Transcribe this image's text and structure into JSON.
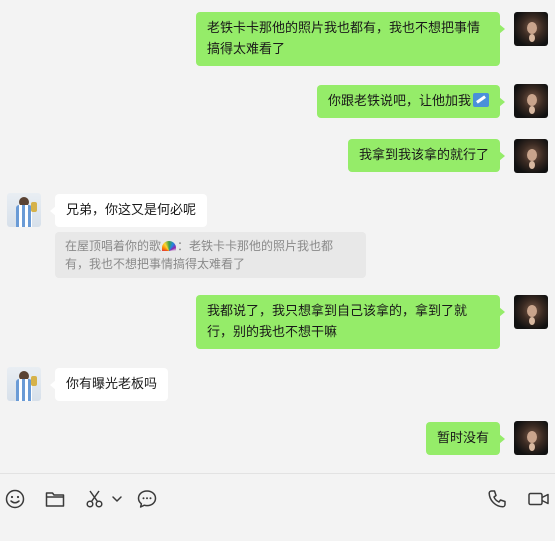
{
  "messages": [
    {
      "side": "me",
      "text": "老铁卡卡那他的照片我也都有，我也不想把事情搞得太难看了"
    },
    {
      "side": "me",
      "text": "你跟老铁说吧，让他加我",
      "emoji": "airplane"
    },
    {
      "side": "me",
      "text": "我拿到我该拿的就行了"
    },
    {
      "side": "friend",
      "text": "兄弟，你这又是何必呢"
    },
    {
      "side": "friend-quote",
      "sender": "在屋顶唱着你的歌",
      "sender_emoji": "rainbow",
      "quote_text": "：老铁卡卡那他的照片我也都有，我也不想把事情搞得太难看了"
    },
    {
      "side": "me",
      "text": "我都说了，我只想拿到自己该拿的，拿到了就行，别的我也不想干嘛"
    },
    {
      "side": "friend",
      "text": "你有曝光老板吗"
    },
    {
      "side": "me",
      "text": "暂时没有"
    }
  ],
  "toolbar": {
    "left_tools": [
      "emoji-icon",
      "folder-icon",
      "scissors-icon",
      "chevron-down-icon",
      "chat-bubble-icon"
    ],
    "right_tools": [
      "phone-icon",
      "video-icon"
    ]
  },
  "colors": {
    "background": "#f3f3f3",
    "me_bubble": "#95ec69",
    "friend_bubble": "#ffffff",
    "quote_bg": "#e8e8e8"
  }
}
